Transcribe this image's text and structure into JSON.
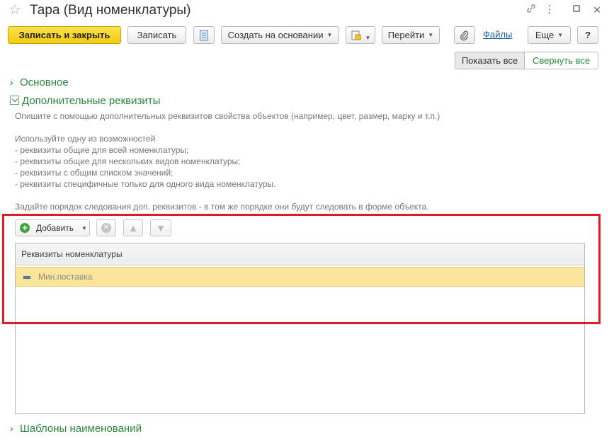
{
  "window": {
    "title": "Тара (Вид номенклатуры)",
    "star_icon": "star-icon",
    "link_icon": "link-icon",
    "menu_icon": "more-icon",
    "restore_icon": "restore-icon",
    "close_icon": "close-icon"
  },
  "toolbar": {
    "save_close": "Записать и закрыть",
    "save": "Записать",
    "create_based_on": "Создать на основании",
    "goto": "Перейти",
    "files": "Файлы",
    "more": "Еще",
    "help": "?"
  },
  "view_toggle": {
    "show_all": "Показать все",
    "collapse_all": "Свернуть все"
  },
  "groups": {
    "main": "Основное",
    "additional": "Дополнительные реквизиты",
    "templates": "Шаблоны наименований"
  },
  "description": {
    "line1": "Опишите с помощью дополнительных реквизитов свойства объектов (например, цвет, размер, марку и т.п.)",
    "line2": "Используйте одну из возможностей",
    "line3": "- реквизиты общие для всей номенклатуры;",
    "line4": "- реквизиты общие для нескольких видов номенклатуры;",
    "line5": "- реквизиты с общим списком значений;",
    "line6": "- реквизиты специфичные только для одного вида номенклатуры.",
    "line7": "Задайте порядок следования доп. реквизитов - в том же порядке они будут следовать в форме объекта."
  },
  "table_toolbar": {
    "add": "Добавить"
  },
  "table": {
    "column": "Реквизиты номенклатуры",
    "rows": [
      "Мин.поставка"
    ]
  },
  "colors": {
    "accent_green": "#2b8a3e",
    "primary_yellow": "#f2cb14",
    "selection": "#fbe59a",
    "highlight_red": "#e01e25"
  }
}
